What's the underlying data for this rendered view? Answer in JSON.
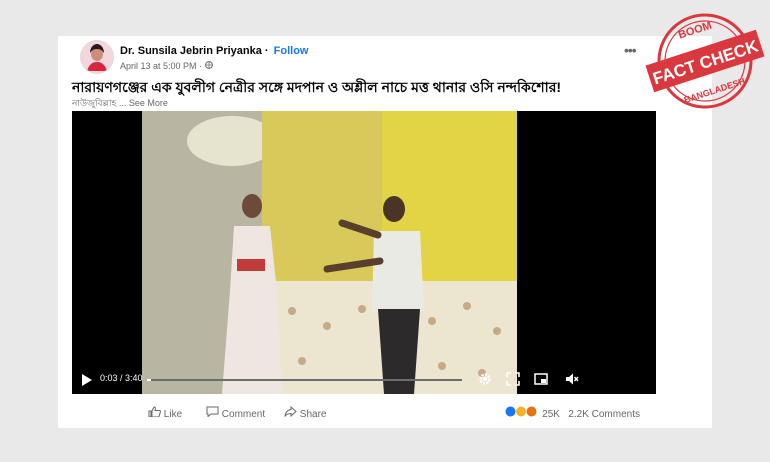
{
  "post": {
    "author": "Dr. Sunsila Jebrin Priyanka",
    "follow_label": "Follow",
    "timestamp": "April 13 at 5:00 PM",
    "title": "নারায়ণগঞ্জের এক যুবলীগ নেত্রীর সঙ্গে মদপান ও অশ্লীল নাচে মত্ত থানার ওসি নন্দকিশোর!",
    "subtitle": "নাউজুবিল্লাহ",
    "see_more": "... See More"
  },
  "video": {
    "time": "0:03 / 3:40",
    "progress": 0.014
  },
  "actions": {
    "like": "Like",
    "comment": "Comment",
    "share": "Share",
    "reaction_count": "25K",
    "comments_count": "2.2K Comments"
  },
  "stamp": {
    "top": "BOOM",
    "main": "FACT CHECK",
    "bottom": "BANGLADESH",
    "color": "#d9383e"
  }
}
